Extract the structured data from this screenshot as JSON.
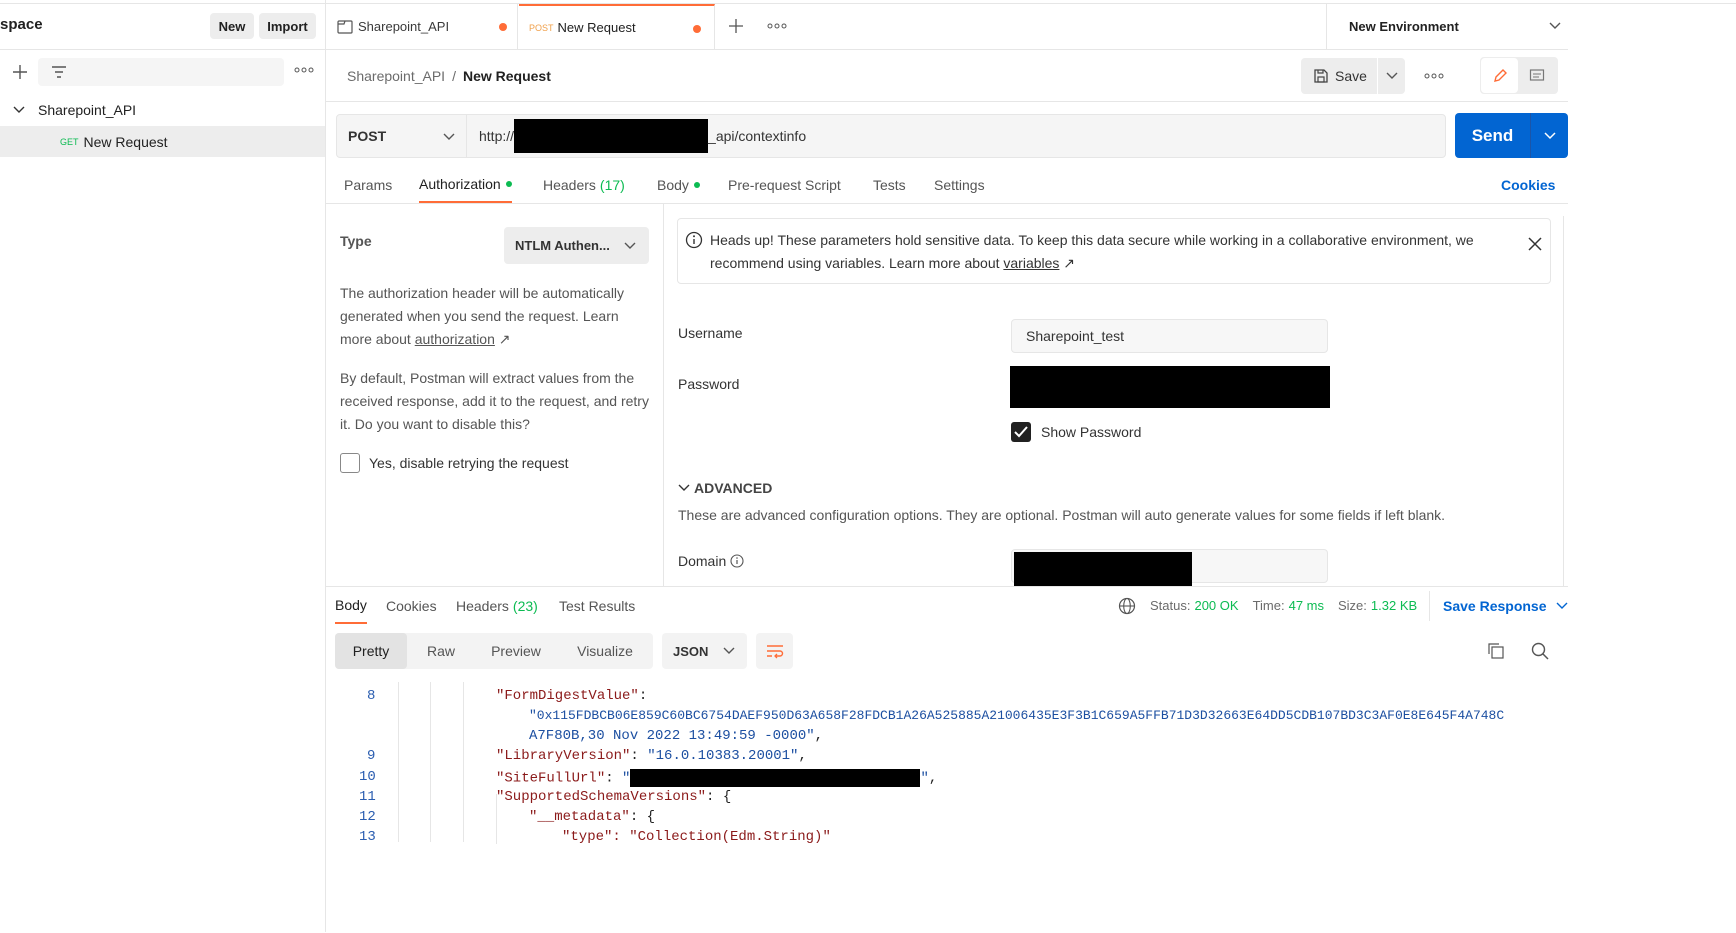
{
  "sidebar": {
    "workspace_title": "space",
    "new_label": "New",
    "import_label": "Import",
    "collection_name": "Sharepoint_API",
    "request_method": "GET",
    "request_name": "New Request"
  },
  "tabs": [
    {
      "label": "Sharepoint_API"
    },
    {
      "method": "POST",
      "label": "New Request"
    }
  ],
  "environment": {
    "label": "New Environment"
  },
  "breadcrumb": {
    "collection": "Sharepoint_API",
    "separator": "/",
    "request": "New Request"
  },
  "toolbar": {
    "save_label": "Save"
  },
  "request": {
    "method": "POST",
    "url_prefix": "http://",
    "url_suffix": "_api/contextinfo",
    "send_label": "Send"
  },
  "request_tabs": {
    "params": "Params",
    "authorization": "Authorization",
    "headers": "Headers",
    "headers_count": "(17)",
    "body": "Body",
    "prerequest": "Pre-request Script",
    "tests": "Tests",
    "settings": "Settings",
    "cookies": "Cookies"
  },
  "auth": {
    "type_label": "Type",
    "type_value": "NTLM Authen...",
    "desc1": "The authorization header will be automatically generated when you send the request. Learn more about",
    "desc1_link": "authorization",
    "desc2": "By default, Postman will extract values from the received response, add it to the request, and retry it. Do you want to disable this?",
    "retry_label": "Yes, disable retrying the request",
    "notice_text": "Heads up! These parameters hold sensitive data. To keep this data secure while working in a collaborative environment, we recommend using variables. Learn more about",
    "notice_link": "variables",
    "username_label": "Username",
    "username_value": "Sharepoint_test",
    "password_label": "Password",
    "show_password_label": "Show Password",
    "advanced_label": "ADVANCED",
    "advanced_desc": "These are advanced configuration options. They are optional. Postman will auto generate values for some fields if left blank.",
    "domain_label": "Domain"
  },
  "response": {
    "tabs": {
      "body": "Body",
      "cookies": "Cookies",
      "headers": "Headers",
      "headers_count": "(23)",
      "tests": "Test Results"
    },
    "status_label": "Status:",
    "status_value": "200 OK",
    "time_label": "Time:",
    "time_value": "47 ms",
    "size_label": "Size:",
    "size_value": "1.32 KB",
    "save_response": "Save Response",
    "views": {
      "pretty": "Pretty",
      "raw": "Raw",
      "preview": "Preview",
      "visualize": "Visualize"
    },
    "format": "JSON"
  },
  "code": {
    "l8": "8",
    "l8_key": "\"FormDigestValue\"",
    "l8_val1": "\"0x115FDBCB06E859C60BC6754DAEF950D63A658F28FDCB1A26A525885A21006435E3F3B1C659A5FFB71D3D32663E64DD5CDB107BD3C3AF0E8E645F4A748C",
    "l8_val2": "A7F80B,30 Nov 2022 13:49:59 -0000\"",
    "l9": "9",
    "l9_key": "\"LibraryVersion\"",
    "l9_val": "\"16.0.10383.20001\"",
    "l10": "10",
    "l10_key": "\"SiteFullUrl\"",
    "l11": "11",
    "l11_key": "\"SupportedSchemaVersions\"",
    "l12": "12",
    "l12_key": "\"__metadata\"",
    "l13": "13",
    "l13_text": "\"type\": \"Collection(Edm.String)\""
  },
  "colors": {
    "accent": "#ff6c37",
    "send": "#0265d2",
    "status": "#0cbb52"
  }
}
